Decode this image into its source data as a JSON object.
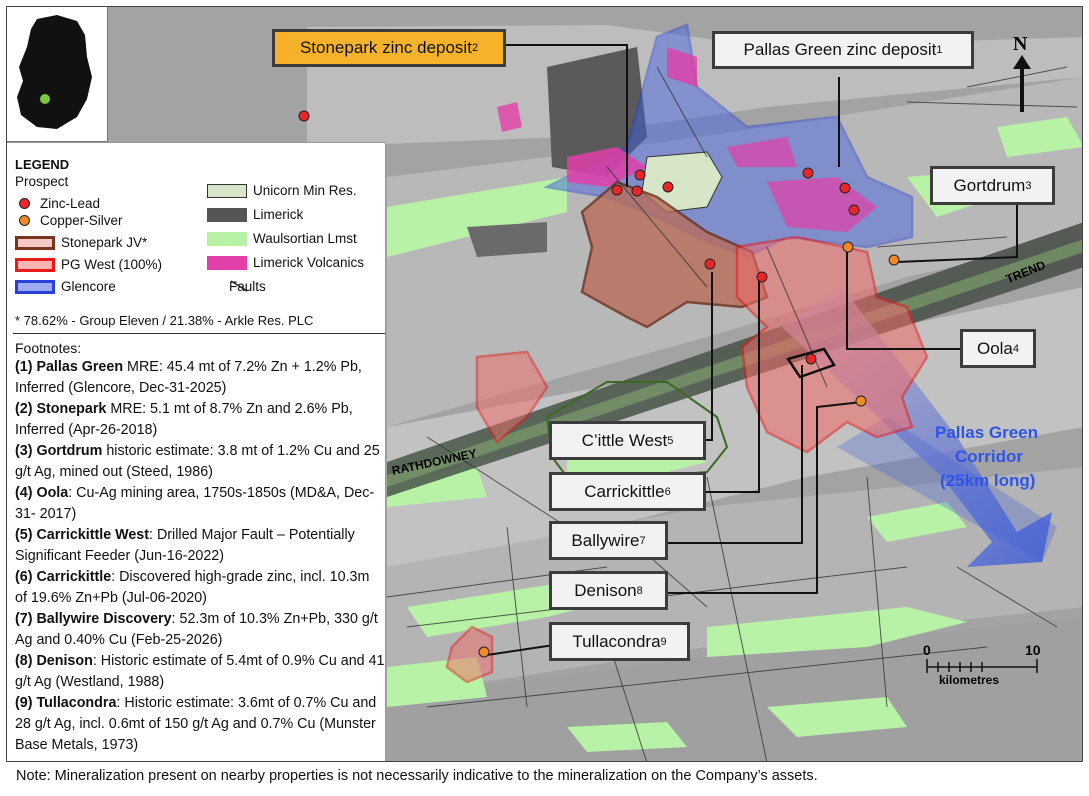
{
  "map": {
    "north_label": "N",
    "trend_label": "TREND",
    "rathdowney_label": "RATHDOWNEY",
    "corridor_label": [
      "Pallas Green",
      "Corridor",
      "(25km long)"
    ],
    "scale": {
      "start": "0",
      "end": "10",
      "unit": "kilometres"
    },
    "colors": {
      "unicorn": "#d7e6c8",
      "limerick": "#555555",
      "waulsortian": "#b7f2a6",
      "volcanics": "#e23fa8",
      "stonepark": "#b86d5a",
      "pg_west": "#f36a6a",
      "glencore": "#3d5ee6",
      "zinc": "#e8262a",
      "copper": "#f08a24"
    }
  },
  "callouts": {
    "stonepark": {
      "text": "Stonepark zinc deposit",
      "note": "2"
    },
    "pallas": {
      "text": "Pallas Green zinc deposit",
      "note": "1"
    },
    "gortdrum": {
      "text": "Gortdrum",
      "note": "3"
    },
    "oola": {
      "text": "Oola",
      "note": "4"
    },
    "cittle": {
      "text": "C’ittle West",
      "note": "5"
    },
    "carrick": {
      "text": "Carrickittle",
      "note": "6"
    },
    "ballywire": {
      "text": "Ballywire",
      "note": "7"
    },
    "denison": {
      "text": "Denison",
      "note": "8"
    },
    "tulla": {
      "text": "Tullacondra",
      "note": "9"
    }
  },
  "legend": {
    "title": "LEGEND",
    "prospect": "Prospect",
    "zinc_lead": "Zinc-Lead",
    "copper_silver": "Copper-Silver",
    "stonepark_jv": "Stonepark JV*",
    "pg_west": "PG West (100%)",
    "glencore": "Glencore",
    "unicorn": "Unicorn Min Res.",
    "limerick": "Limerick",
    "waulsortian": "Waulsortian Lmst",
    "volcanics": "Limerick Volcanics",
    "faults": "Faults",
    "ownership": "* 78.62% - Group Eleven / 21.38% - Arkle Res. PLC"
  },
  "footnotes": {
    "title": "Footnotes:",
    "items": [
      {
        "head": "(1) Pallas Green",
        "body": " MRE: 45.4 mt of 7.2% Zn + 1.2% Pb, Inferred (Glencore, Dec-31-2025)"
      },
      {
        "head": "(2) Stonepark",
        "body": " MRE:  5.1 mt of 8.7% Zn and 2.6% Pb, Inferred (Apr-26-2018)"
      },
      {
        "head": "(3) Gortdrum",
        "body": " historic estimate: 3.8 mt of 1.2% Cu and 25 g/t Ag, mined out (Steed, 1986)"
      },
      {
        "head": "(4) Oola",
        "body": ": Cu-Ag mining area, 1750s-1850s (MD&A, Dec-31- 2017)"
      },
      {
        "head": "(5) Carrickittle West",
        "body": ": Drilled Major Fault – Potentially Significant Feeder (Jun-16-2022)"
      },
      {
        "head": "(6) Carrickittle",
        "body": ": Discovered high-grade zinc, incl. 10.3m of 19.6% Zn+Pb (Jul-06-2020)"
      },
      {
        "head": "(7) Ballywire Discovery",
        "body": ": 52.3m of 10.3% Zn+Pb, 330 g/t Ag and 0.40% Cu (Feb-25-2026)"
      },
      {
        "head": "(8) Denison",
        "body": ": Historic estimate of 5.4mt of 0.9% Cu and 41 g/t Ag (Westland, 1988)"
      },
      {
        "head": "(9) Tullacondra",
        "body": ": Historic estimate: 3.6mt of 0.7% Cu and 28 g/t Ag, incl. 0.6mt of 150 g/t Ag and 0.7% Cu (Munster Base Metals, 1973)"
      }
    ]
  },
  "note": "Note: Mineralization present on nearby properties is not necessarily indicative to the mineralization on the Company’s assets."
}
